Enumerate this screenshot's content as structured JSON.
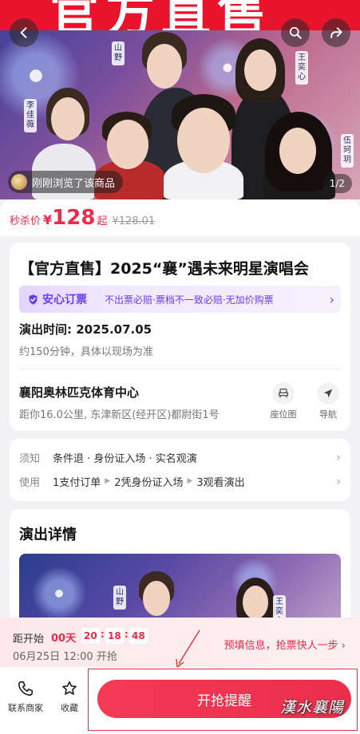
{
  "hero": {
    "banner_text": "官方直售",
    "names": [
      "山野",
      "王奕心",
      "李佳薇",
      "伍珂玥"
    ],
    "recent_view_text": "刚刚浏览了该商品",
    "page_indicator": "1/2"
  },
  "price": {
    "label": "秒杀价",
    "currency": "¥",
    "amount": "128",
    "suffix": "起",
    "original": "¥128.01"
  },
  "event": {
    "title": "【官方直售】2025“襄”遇未来明星演唱会",
    "guarantee_label": "安心订票",
    "guarantee_text": "不出票必赔·票档不一致必赔·无加价购票",
    "time_label": "演出时间: 2025.07.05",
    "duration": "约150分钟，具体以现场为准",
    "venue": "襄阳奥林匹克体育中心",
    "address": "距你16.0公里, 东津新区(经开区)都尉街1号",
    "seat_map_label": "座位图",
    "navigate_label": "导航"
  },
  "notice": {
    "key1": "须知",
    "value1": "条件退 · 身份证入场 · 实名观演",
    "key2": "使用",
    "steps": [
      "1支付订单",
      "2凭身份证入场",
      "3观看演出"
    ]
  },
  "details": {
    "title": "演出详情",
    "poster_names": [
      "山野",
      "王奕心"
    ]
  },
  "countdown": {
    "label": "距开始",
    "days": "00天",
    "hours": "20",
    "minutes": "18",
    "seconds": "48",
    "open_time": "06月25日 12:00 开抢",
    "promo": "预填信息，抢票快人一步 ›"
  },
  "bottom": {
    "contact_label": "联系商家",
    "favorite_label": "收藏",
    "remind_label": "开抢提醒"
  },
  "watermark": "漢水襄陽",
  "colors": {
    "accent": "#ee2a4a",
    "guarantee": "#6a3ef0"
  }
}
